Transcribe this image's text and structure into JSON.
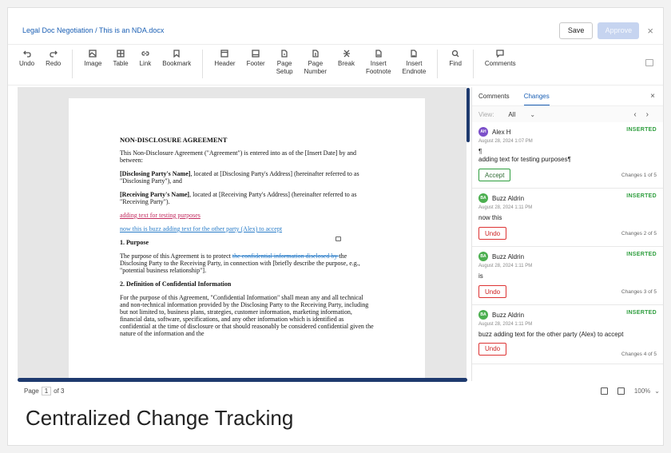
{
  "header": {
    "breadcrumb_root": "Legal Doc Negotiation",
    "breadcrumb_sep": " / ",
    "breadcrumb_file": "This is an NDA.docx",
    "save_label": "Save",
    "approve_label": "Approve",
    "close_glyph": "×"
  },
  "toolbar": {
    "undo": "Undo",
    "redo": "Redo",
    "image": "Image",
    "table": "Table",
    "link": "Link",
    "bookmark": "Bookmark",
    "header": "Header",
    "footer": "Footer",
    "page_setup": "Page\nSetup",
    "page_number": "Page\nNumber",
    "break": "Break",
    "insert_footnote": "Insert\nFootnote",
    "insert_endnote": "Insert\nEndnote",
    "find": "Find",
    "comments": "Comments"
  },
  "document": {
    "title": "NON-DISCLOSURE AGREEMENT",
    "intro": "This Non-Disclosure Agreement (\"Agreement\") is entered into as of the [Insert Date] by and between:",
    "disclosing_bold": "[Disclosing Party's Name]",
    "disclosing_rest": ", located at [Disclosing Party's Address] (hereinafter referred to as \"Disclosing Party\"), and",
    "receiving_bold": "[Receiving Party's Name]",
    "receiving_rest": ", located at [Receiving Party's Address] (hereinafter referred to as \"Receiving Party\").",
    "inserted_red": "adding text for testing purposes",
    "inserted_blue": "now this is buzz adding text for the other party (Alex) to accept",
    "section1_heading": "1. Purpose",
    "section1_pre": "The purpose of this Agreement is to protect ",
    "section1_deleted": "the confidential information disclosed by ",
    "section1_post": "the Disclosing Party to the Receiving Party, in connection with [briefly describe the purpose, e.g., \"potential business relationship\"].",
    "section2_heading": "2. Definition of Confidential Information",
    "section2_text": "For the purpose of this Agreement, \"Confidential Information\" shall mean any and all technical and non-technical information provided by the Disclosing Party to the Receiving Party, including but not limited to, business plans, strategies, customer information, marketing information, financial data, software, specifications, and any other information which is identified as confidential at the time of disclosure or that should reasonably be considered confidential given the nature of the information and the"
  },
  "status": {
    "page_label": "Page",
    "page_current": "1",
    "page_of": "of 3",
    "zoom": "100%"
  },
  "panel": {
    "tab_comments": "Comments",
    "tab_changes": "Changes",
    "filter_label": "View:",
    "filter_value": "All",
    "close_glyph": "×",
    "changes": [
      {
        "initials": "AH",
        "avatar_color": "#7b4fc9",
        "author": "Alex H",
        "type": "INSERTED",
        "time": "August 28, 2024 1:07 PM",
        "pilcrow": "¶",
        "text": "adding text for testing purposes¶",
        "action": "Accept",
        "count": "Changes 1 of 5"
      },
      {
        "initials": "BA",
        "avatar_color": "#4caf50",
        "author": "Buzz Aldrin",
        "type": "INSERTED",
        "time": "August 28, 2024 1:11 PM",
        "text": "now this",
        "action": "Undo",
        "count": "Changes 2 of 5"
      },
      {
        "initials": "BA",
        "avatar_color": "#4caf50",
        "author": "Buzz Aldrin",
        "type": "INSERTED",
        "time": "August 28, 2024 1:11 PM",
        "text": "is",
        "action": "Undo",
        "count": "Changes 3 of 5"
      },
      {
        "initials": "BA",
        "avatar_color": "#4caf50",
        "author": "Buzz Aldrin",
        "type": "INSERTED",
        "time": "August 28, 2024 1:11 PM",
        "text": "buzz adding text for the other party (Alex) to accept",
        "action": "Undo",
        "count": "Changes 4 of 5"
      }
    ]
  },
  "caption": "Centralized Change Tracking"
}
